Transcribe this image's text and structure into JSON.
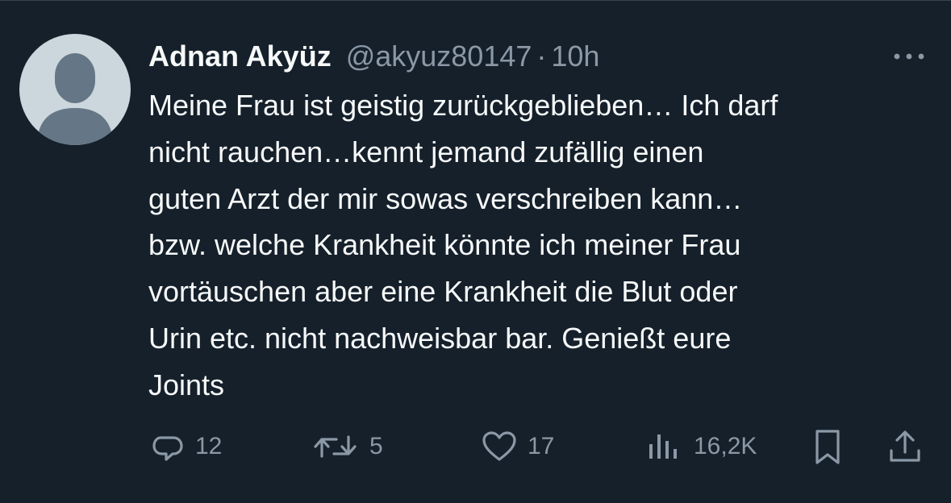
{
  "tweet": {
    "author": {
      "display_name": "Adnan Akyüz",
      "handle": "@akyuz80147",
      "avatar": "default-avatar-icon"
    },
    "separator": "·",
    "timestamp": "10h",
    "text": "Meine Frau ist geistig zurückgeblieben… Ich darf\nnicht rauchen…kennt jemand zufällig einen\nguten Arzt der mir sowas verschreiben kann…\nbzw. welche Krankheit könnte ich meiner Frau\nvortäuschen aber eine Krankheit die Blut oder\nUrin etc. nicht nachweisbar bar. Genießt eure\nJoints"
  },
  "actions": {
    "reply": {
      "icon": "reply-icon",
      "count": "12"
    },
    "retweet": {
      "icon": "retweet-icon",
      "count": "5"
    },
    "like": {
      "icon": "heart-icon",
      "count": "17"
    },
    "views": {
      "icon": "views-icon",
      "count": "16,2K"
    },
    "bookmark": {
      "icon": "bookmark-icon"
    },
    "share": {
      "icon": "share-icon"
    },
    "more": {
      "icon": "more-icon"
    }
  },
  "colors": {
    "background": "#15202b",
    "text_primary": "#f7f9f9",
    "text_secondary": "#8b98a5",
    "avatar_bg": "#ccd6dd",
    "avatar_fg": "#657786",
    "divider": "#38444d"
  }
}
